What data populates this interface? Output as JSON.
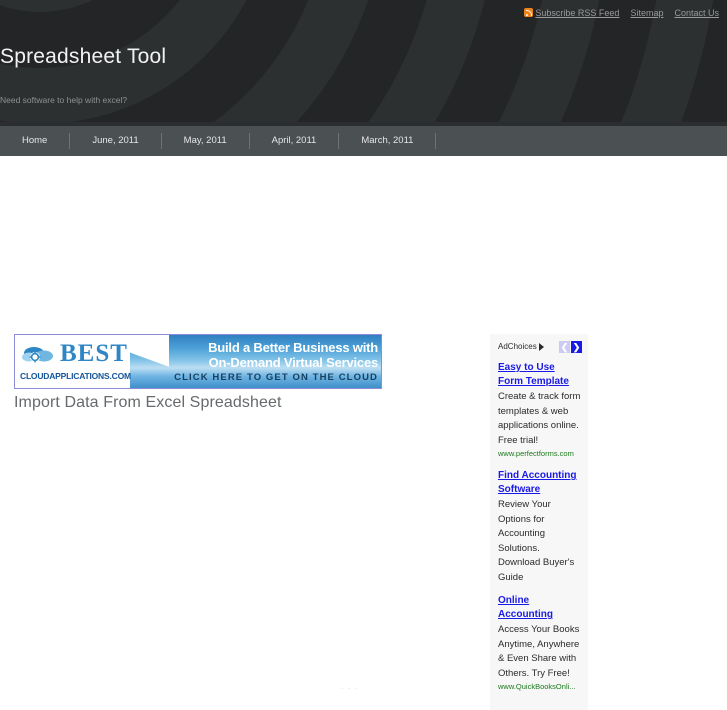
{
  "header": {
    "site_title": "Spreadsheet Tool",
    "tagline": "Need software to help with excel?",
    "rss_icon": "rss-icon",
    "top_links": [
      {
        "label": "Subscribe RSS Feed"
      },
      {
        "label": "Sitemap"
      },
      {
        "label": "Contact Us"
      }
    ],
    "bg_color": "#303335",
    "arc_color": "#26282a"
  },
  "nav": {
    "bg_color": "#4b5053",
    "items": [
      {
        "label": "Home"
      },
      {
        "label": "June, 2011"
      },
      {
        "label": "May, 2011"
      },
      {
        "label": "April, 2011"
      },
      {
        "label": "March, 2011"
      }
    ]
  },
  "banner_ad": {
    "brand": "BEST",
    "brand_domain": "CLOUDAPPLICATIONS.COM",
    "headline_line1": "Build a Better Business with",
    "headline_line2": "On-Demand Virtual Services",
    "cta": "CLICK HERE TO GET ON THE CLOUD",
    "logo_icon": "cloud-gear-icon",
    "border_color": "#8c8cd8"
  },
  "post": {
    "title": "Import Data From Excel Spreadsheet"
  },
  "artifacts": {
    "dots": "· · ·",
    "bottom_sliver": ""
  },
  "sidebar": {
    "adchoices": {
      "label": "AdChoices",
      "triangle_icon": "adchoices-triangle-icon",
      "prev_icon": "❮",
      "next_icon": "❯",
      "prev_color": "#ccccf2",
      "next_color": "#1a1ae6"
    },
    "ads": [
      {
        "title": "Easy to Use Form Template",
        "description": "Create & track form templates & web applications online. Free trial!",
        "url": "www.perfectforms.com"
      },
      {
        "title": "Find Accounting Software",
        "description": "Review Your Options for Accounting Solutions. Download Buyer's Guide",
        "url": ""
      },
      {
        "title": "Online Accounting",
        "description": "Access Your Books Anytime, Anywhere & Even Share with Others. Try Free!",
        "url": "www.QuickBooksOnli..."
      }
    ]
  }
}
